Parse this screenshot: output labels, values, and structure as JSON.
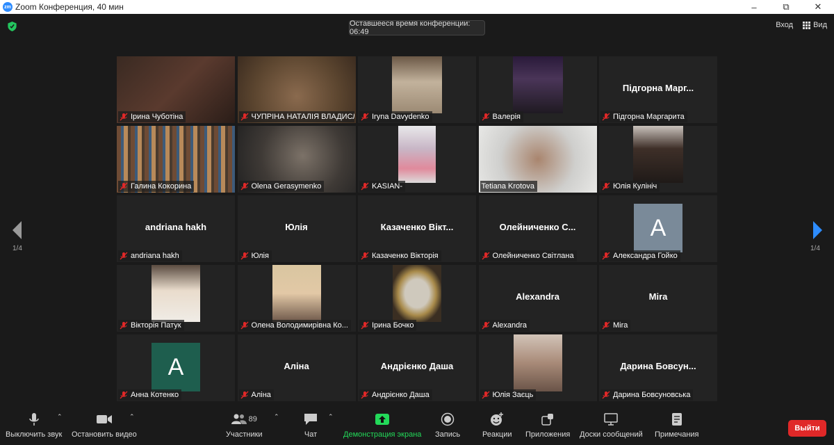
{
  "window": {
    "title": "Zoom Конференция, 40 мин",
    "logo": "zm"
  },
  "meeting": {
    "timer": "Оставшееся время конференции: 06:49",
    "enter_label": "Вход",
    "view_label": "Вид",
    "page_left": "1/4",
    "page_right": "1/4"
  },
  "tiles": [
    {
      "name": "Ірина Чуботіна",
      "type": "photo"
    },
    {
      "name": "ЧУПРІНА НАТАЛІЯ ВЛАДИСЛ...",
      "type": "photo"
    },
    {
      "name": "Iryna Davydenko",
      "type": "photo"
    },
    {
      "name": "Валерія",
      "type": "photo"
    },
    {
      "name": "Підгорна Маргарита",
      "big": "Підгорна  Марг...",
      "type": "text"
    },
    {
      "name": "Галина Кокорина",
      "type": "photo"
    },
    {
      "name": "Olena Gerasymenko",
      "type": "photo"
    },
    {
      "name": "KASIAN-",
      "type": "photo"
    },
    {
      "name": "Tetiana Krotova",
      "type": "photo",
      "active": true
    },
    {
      "name": "Юлія Кулініч",
      "type": "photo"
    },
    {
      "name": "andriana hakh",
      "big": "andriana hakh",
      "type": "text"
    },
    {
      "name": "Юлія",
      "big": "Юлія",
      "type": "text"
    },
    {
      "name": "Казаченко Вікторія",
      "big": "Казаченко  Вікт...",
      "type": "text"
    },
    {
      "name": "Олейниченко Світлана",
      "big": "Олейниченко  С...",
      "type": "text"
    },
    {
      "name": "Александра Гойко",
      "letter": "A",
      "avatar_color": "#7a8a99",
      "type": "avatar"
    },
    {
      "name": "Вікторія Патук",
      "type": "photo"
    },
    {
      "name": "Олена Володимирівна Ко...",
      "type": "photo"
    },
    {
      "name": "Ірина Бочко",
      "type": "photo"
    },
    {
      "name": "Alexandra",
      "big": "Alexandra",
      "type": "text"
    },
    {
      "name": "Mira",
      "big": "Mira",
      "type": "text"
    },
    {
      "name": "Анна Котенко",
      "letter": "A",
      "avatar_color": "#1e5e4e",
      "type": "avatar"
    },
    {
      "name": "Аліна",
      "big": "Аліна",
      "type": "text"
    },
    {
      "name": "Андрієнко Даша",
      "big": "Андрієнко Даша",
      "type": "text"
    },
    {
      "name": "Юлія Заєць",
      "type": "photo"
    },
    {
      "name": "Дарина Бовсуновська",
      "big": "Дарина  Бовсун...",
      "type": "text"
    }
  ],
  "toolbar": {
    "mute": "Выключить звук",
    "video": "Остановить видео",
    "participants": "Участники",
    "participants_count": "89",
    "chat": "Чат",
    "share": "Демонстрация экрана",
    "record": "Запись",
    "reactions": "Реакции",
    "apps": "Приложения",
    "whiteboards": "Доски сообщений",
    "notes": "Примечания",
    "exit": "Выйти"
  },
  "colors": {
    "accent": "#2d8cff",
    "share_green": "#23d959",
    "exit_red": "#e02828",
    "active_speaker": "#c9e86e"
  }
}
